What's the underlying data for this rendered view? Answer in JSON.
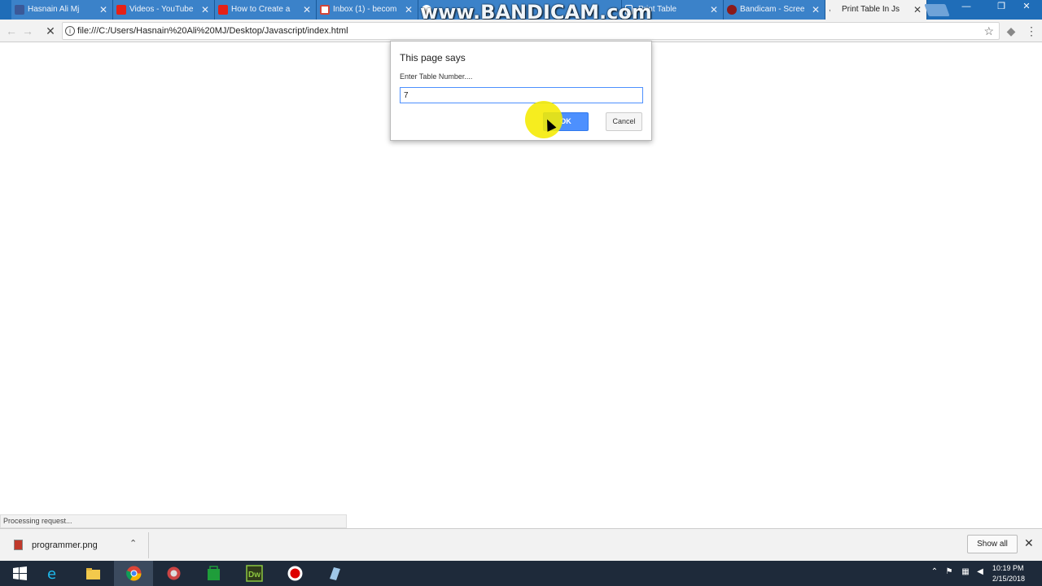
{
  "tabs": [
    {
      "label": "Hasnain Ali Mj",
      "icon": "facebook-icon",
      "color": "#3b5998"
    },
    {
      "label": "Videos - YouTube",
      "icon": "youtube-icon",
      "color": "#e62117"
    },
    {
      "label": "How to Create a",
      "icon": "youtube-icon",
      "color": "#e62117"
    },
    {
      "label": "Inbox (1) - becom",
      "icon": "gmail-icon",
      "color": "#d44638"
    },
    {
      "label": "",
      "icon": "google-icon",
      "color": "#ffffff"
    },
    {
      "label": "Print Table",
      "icon": "page-icon",
      "color": "#ffffff"
    },
    {
      "label": "Bandicam - Scree",
      "icon": "bandicam-icon",
      "color": "#8b1a1a"
    },
    {
      "label": "Print Table In Js",
      "icon": "loading-icon",
      "color": "#f2f2f2"
    }
  ],
  "watermark": "www.BANDICAM.com",
  "address": {
    "url": "file:///C:/Users/Hasnain%20Ali%20MJ/Desktop/Javascript/index.html"
  },
  "dialog": {
    "title": "This page says",
    "message": "Enter Table Number....",
    "input_value": "7",
    "ok_label": "OK",
    "cancel_label": "Cancel"
  },
  "status_text": "Processing request...",
  "downloads": {
    "file_name": "programmer.png",
    "show_all_label": "Show all"
  },
  "taskbar": {
    "apps": [
      "windows-start-icon",
      "internet-explorer-icon",
      "file-explorer-icon",
      "chrome-icon",
      "app-icon",
      "store-icon",
      "dreamweaver-icon",
      "bandicam-record-icon",
      "notes-icon"
    ],
    "dw_label": "Dw",
    "time": "10:19 PM",
    "date": "2/15/2018"
  },
  "colors": {
    "tabstrip": "#1f6db8",
    "ok_button": "#4d90fe",
    "taskbar": "#1e2a3a"
  }
}
